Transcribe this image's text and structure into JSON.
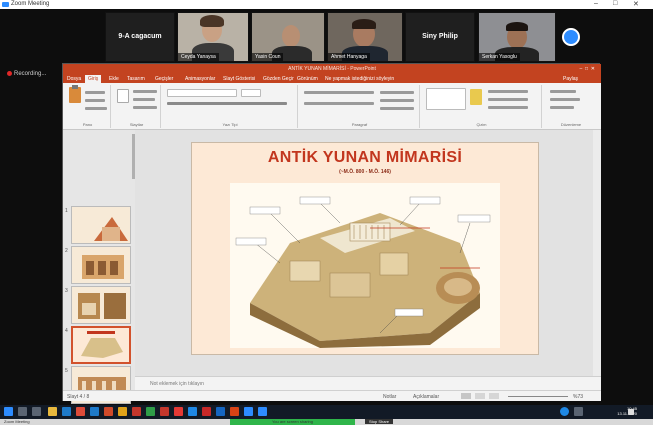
{
  "window": {
    "app_title": "Zoom Meeting",
    "controls": [
      "–",
      "□",
      "✕"
    ]
  },
  "zoom": {
    "participants": [
      {
        "name": "9-A cagacum",
        "video": false
      },
      {
        "name": "Ceyda Yanaysa",
        "video": true
      },
      {
        "name": "Yasin Coun",
        "video": true
      },
      {
        "name": "Ahmet Hanyaga",
        "video": true
      },
      {
        "name": "Siny Philip",
        "video": false
      },
      {
        "name": "Serkan Yasoglu",
        "video": true
      }
    ],
    "recording_label": "Recording...",
    "avatar_initial": "",
    "colors": {
      "recording_dot": "#e02828",
      "accent": "#2d8cff"
    }
  },
  "powerpoint": {
    "window_title": "ANTİK YUNAN MİMARİSİ - PowerPoint",
    "tabs": [
      "Dosya",
      "Giriş",
      "Ekle",
      "Tasarım",
      "Geçişler",
      "Animasyonlar",
      "Slayt Gösterisi",
      "Gözden Geçir",
      "Görünüm",
      "Ne yapmak istediğinizi söyleyin"
    ],
    "active_tab": "Giriş",
    "share_label": "Paylaş",
    "ribbon_groups": [
      "Pano",
      "Slaytlar",
      "Yazı Tipi",
      "Paragraf",
      "Çizim",
      "Düzenleme"
    ],
    "thumbnails": [
      {
        "number": "1",
        "selected": false
      },
      {
        "number": "2",
        "selected": false
      },
      {
        "number": "3",
        "selected": false
      },
      {
        "number": "4",
        "selected": true
      },
      {
        "number": "5",
        "selected": false
      },
      {
        "number": "6",
        "selected": false
      }
    ],
    "slide": {
      "title": "ANTİK YUNAN MİMARİSİ",
      "subtitle": "(~M.Ö. 800 - M.Ö. 146)"
    },
    "notes_placeholder": "Not eklemek için tıklayın",
    "status": {
      "slide_info": "Slayt 4 / 8",
      "notes_button": "Notlar",
      "comments_button": "Açıklamalar",
      "zoom_level": "%73"
    },
    "colors": {
      "brand": "#c34320",
      "slide_title": "#c2361e",
      "slide_bg": "#fde9d6"
    }
  },
  "taskbar": {
    "time": "10:45",
    "date": "13.11.2020",
    "screen_share_label": "You are screen sharing",
    "stop_share_label": "Stop Share"
  }
}
